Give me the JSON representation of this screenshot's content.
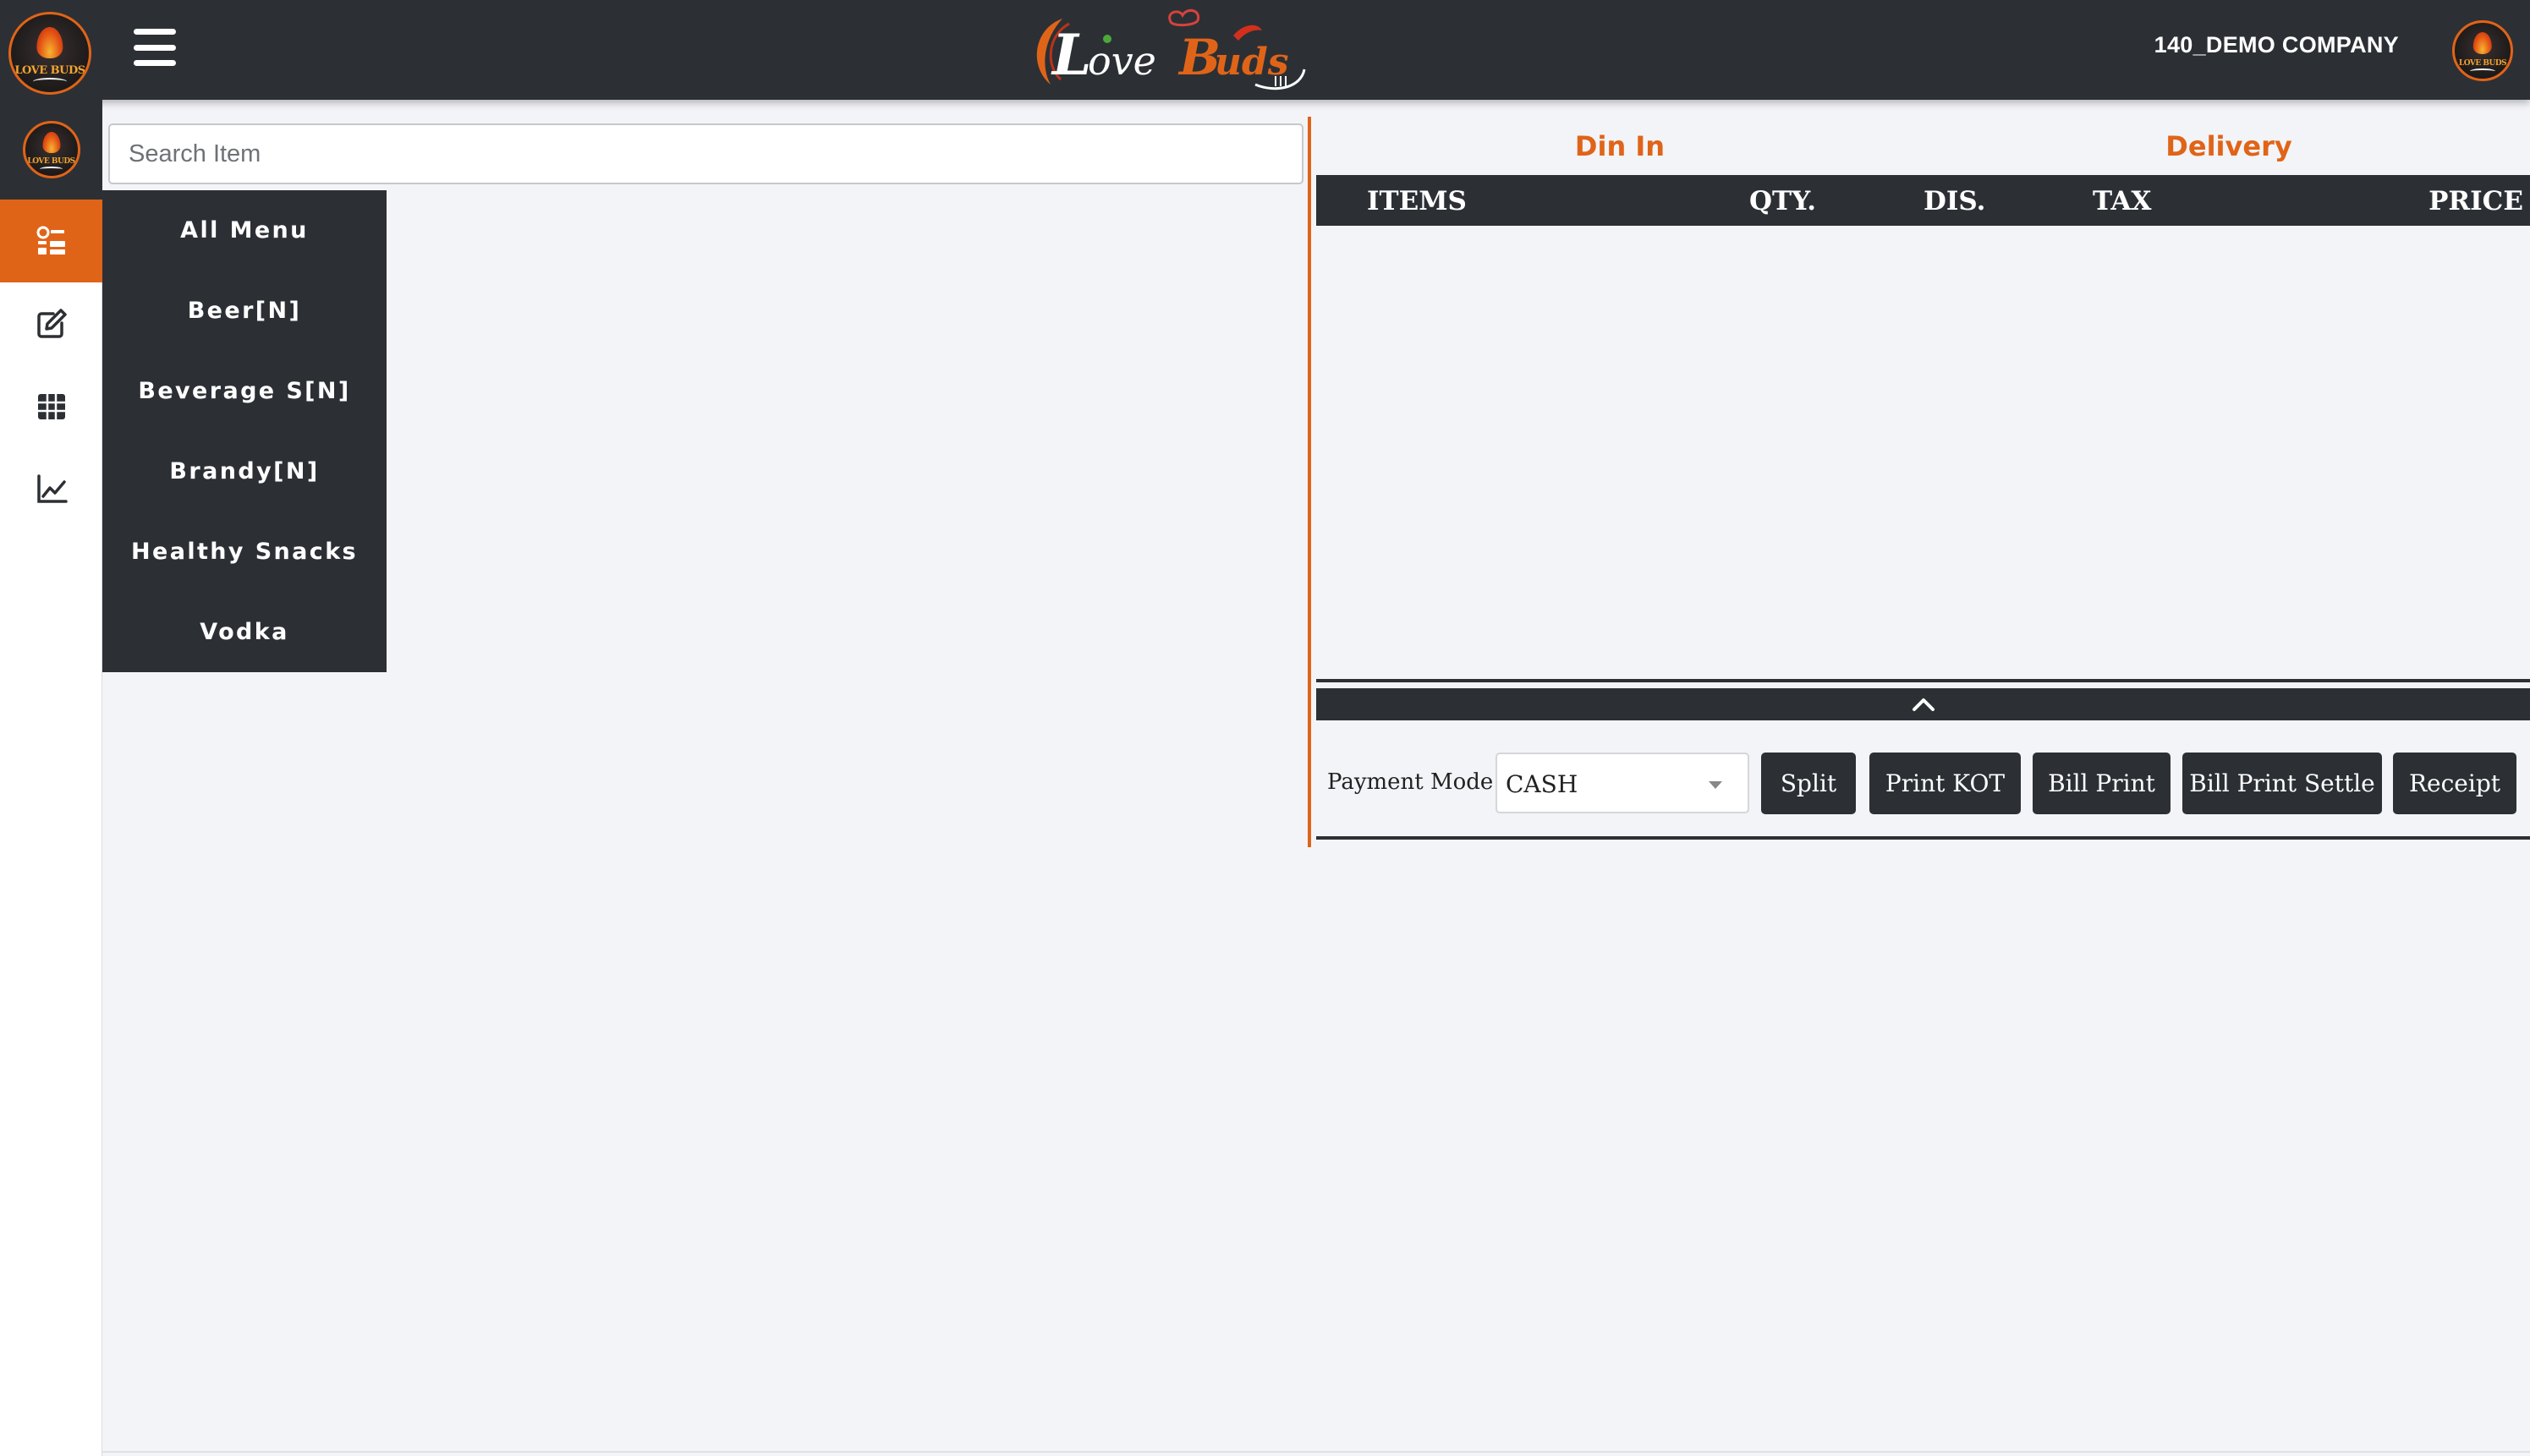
{
  "header": {
    "brand": "Love Buds",
    "logo_text": "LOVE BUDS",
    "company": "140_DEMO COMPANY"
  },
  "sidebar": {
    "items": [
      {
        "icon": "menu-list-icon",
        "active": true
      },
      {
        "icon": "edit-icon",
        "active": false
      },
      {
        "icon": "table-grid-icon",
        "active": false
      },
      {
        "icon": "line-chart-icon",
        "active": false
      }
    ]
  },
  "search": {
    "placeholder": "Search Item",
    "value": ""
  },
  "categories": [
    "All Menu",
    "Beer[N]",
    "Beverage S[N]",
    "Brandy[N]",
    "Healthy Snacks",
    "Vodka"
  ],
  "order": {
    "types": {
      "din_in": "Din In",
      "delivery": "Delivery"
    },
    "columns": {
      "items": "ITEMS",
      "qty": "QTY.",
      "dis": "DIS.",
      "tax": "TAX",
      "price": "PRICE"
    },
    "rows": []
  },
  "payment": {
    "label": "Payment Mode:",
    "mode": "CASH",
    "buttons": {
      "split": "Split",
      "print_kot": "Print KOT",
      "bill_print": "Bill Print",
      "bill_print_settle": "Bill Print Settle",
      "receipt": "Receipt"
    }
  },
  "colors": {
    "accent": "#e06418",
    "dark": "#2c3035",
    "background": "#f3f4f8"
  }
}
